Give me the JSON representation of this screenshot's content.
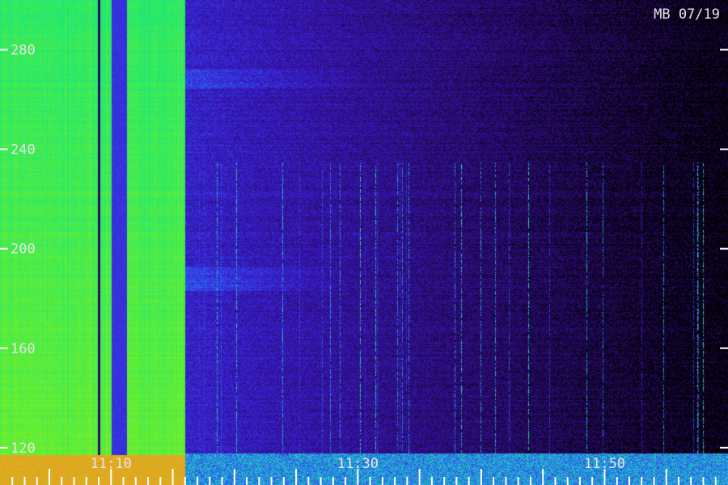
{
  "chart_data": {
    "type": "heatmap",
    "title": "MB 07/19",
    "xlabel": "",
    "ylabel": "",
    "x_ticks": [
      "11:10",
      "11:30",
      "11:50"
    ],
    "x_range": [
      "11:01",
      "12:00"
    ],
    "y_ticks": [
      120,
      160,
      200,
      240,
      280
    ],
    "ylim": [
      105,
      300
    ],
    "colormap": [
      "#000000",
      "#2a0a6e",
      "#3a1fd6",
      "#2a6cf0",
      "#22c8c8",
      "#20e870",
      "#7cf020",
      "#f0a020",
      "#f06020"
    ],
    "regions": [
      {
        "name": "high-level band",
        "x": [
          "11:01",
          "11:16"
        ],
        "level": "high"
      },
      {
        "name": "low-level band",
        "x": [
          "11:16",
          "12:00"
        ],
        "level": "low"
      }
    ],
    "grid": false
  }
}
